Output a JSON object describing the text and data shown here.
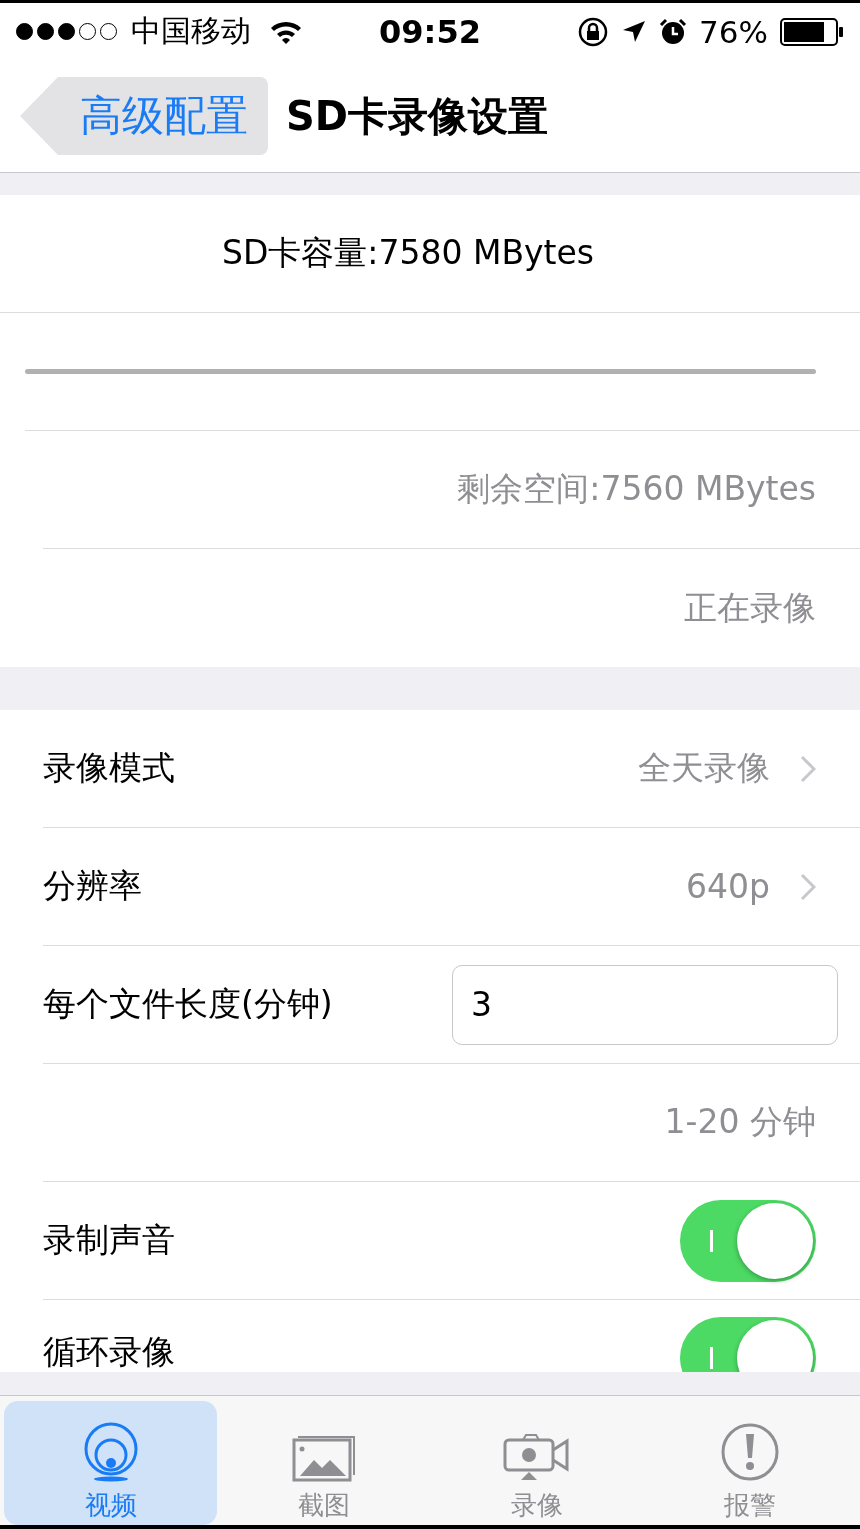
{
  "status_bar": {
    "signal_dots": [
      {
        "filled": true
      },
      {
        "filled": true
      },
      {
        "filled": true
      },
      {
        "filled": false
      },
      {
        "filled": false
      }
    ],
    "carrier": "中国移动",
    "time": "09:52",
    "battery": "76%"
  },
  "nav": {
    "back": "高级配置",
    "title": "SD卡录像设置"
  },
  "storage": {
    "capacity": "SD卡容量:7580 MBytes",
    "remaining": "剩余空间:7560 MBytes",
    "status": "正在录像"
  },
  "settings": [
    {
      "kind": "link",
      "label": "录像模式",
      "value": "全天录像"
    },
    {
      "kind": "link",
      "label": "分辨率",
      "value": "640p"
    },
    {
      "kind": "input",
      "label": "每个文件长度(分钟)",
      "value": "3"
    },
    {
      "kind": "note",
      "label": "1-20 分钟"
    },
    {
      "kind": "toggle",
      "label": "录制声音",
      "on": true
    },
    {
      "kind": "toggle",
      "label": "循环录像",
      "on": true
    }
  ],
  "tabs": [
    {
      "label": "视频",
      "selected": true
    },
    {
      "label": "截图",
      "selected": false
    },
    {
      "label": "录像",
      "selected": false
    },
    {
      "label": "报警",
      "selected": false
    }
  ]
}
